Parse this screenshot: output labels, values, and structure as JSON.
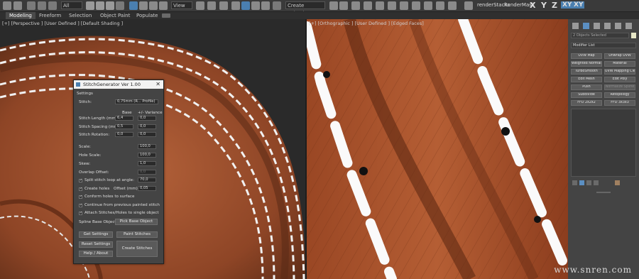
{
  "toolbar": {
    "selection_filter": "All",
    "ref_coord": "View",
    "selection_set": "Create Selection Se",
    "render_stacks": "renderStacks",
    "render_mask": "RenderMask",
    "axis_x": "X",
    "axis_y": "Y",
    "axis_z": "Z",
    "axis_xy": "XY",
    "axis_xy2": "XY"
  },
  "ribbon": {
    "tabs": [
      "Modeling",
      "Freeform",
      "Selection",
      "Object Paint",
      "Populate"
    ]
  },
  "viewport_left": {
    "label": "[+] [Perspective ] [User Defined ] [Default Shading ]"
  },
  "viewport_right": {
    "label": "[+] [Orthographic ] [User Defined ] [Edged Faces]"
  },
  "dialog": {
    "title": "StitchGenerator Ver 1.00",
    "settings_header": "Settings",
    "stitch_label": "Stitch:",
    "stitch_value": "0,75mm (R... Profile)",
    "base_header": "Base",
    "variance_header": "+/- Variance",
    "stitch_length_label": "Stitch Length (mm):",
    "stitch_length_base": "6,4",
    "stitch_length_var": "0,0",
    "stitch_spacing_label": "Stitch Spacing (mm):",
    "stitch_spacing_base": "0,5",
    "stitch_spacing_var": "0,0",
    "stitch_rotation_label": "Stitch Rotation:",
    "stitch_rotation_base": "0,0",
    "stitch_rotation_var": "0,0",
    "scale_label": "Scale:",
    "scale_value": "100,0",
    "hole_scale_label": "Hole Scale:",
    "hole_scale_value": "100,0",
    "skew_label": "Skew:",
    "skew_value": "1,0",
    "overlap_label": "Overlap Offset:",
    "overlap_value": "0,0",
    "split_label": "Split stitch loop at angle:",
    "split_value": "70,0",
    "create_holes_label": "Create holes",
    "offset_label": "Offset (mm):",
    "offset_value": "0,05",
    "conform_label": "Conform holes to surface",
    "continue_label": "Continue from previous painted stitch",
    "attach_label": "Attach Stitches/Holes to single object",
    "spline_label": "Spline Base Object:",
    "pick_label": "Pick Base Object",
    "get_settings": "Get Settings",
    "paint_stitches": "Paint Stitches",
    "reset_settings": "Reset Settings",
    "help_about": "Help / About",
    "create_stitches": "Create Stitches"
  },
  "panel": {
    "objects_selected": "2 Objects Selected",
    "modifier_list": "Modifier List",
    "modifiers": [
      "UVW Map",
      "Unwrap UVW",
      "Weighted Normals",
      "Material",
      "TurboSmooth",
      "UVW Mapping Clear",
      "Edit Mesh",
      "Edit Poly",
      "Push",
      "Normalize Spline",
      "Subdivide",
      "Retopology",
      "FFD 2x2x2",
      "FFD 3x3x3"
    ]
  },
  "watermark": "www.snren.com"
}
